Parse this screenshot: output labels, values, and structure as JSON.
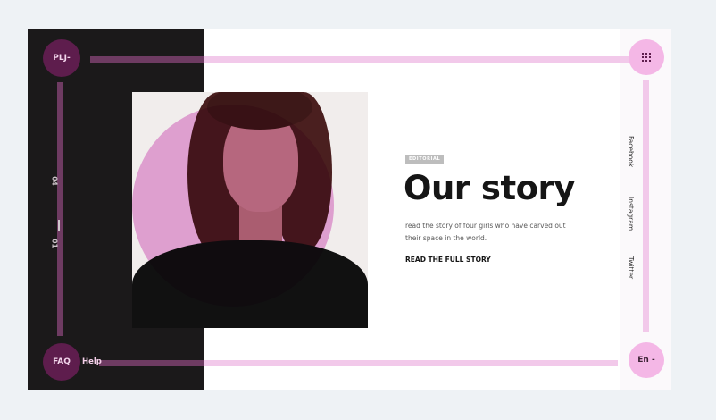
{
  "logo": {
    "text": "PLJ-"
  },
  "nav": {
    "menu_icon": "grid-dots-icon"
  },
  "footer": {
    "faq": "FAQ",
    "help": "Help",
    "language": "En -"
  },
  "counter": {
    "current": "01",
    "total": "04"
  },
  "hero": {
    "badge": "EDITORIAL",
    "title": "Our story",
    "description": "read the story of four girls who have carved out their space in the world.",
    "cta": "READ THE FULL STORY"
  },
  "social": [
    {
      "label": "Facebook"
    },
    {
      "label": "Instagram"
    },
    {
      "label": "Twitter"
    }
  ],
  "colors": {
    "dark_panel": "#1b191a",
    "plum": "#5e1d4d",
    "pink": "#f4b7e6",
    "rail_pink": "#f2c9ea",
    "rail_plum": "#6e3b62"
  }
}
